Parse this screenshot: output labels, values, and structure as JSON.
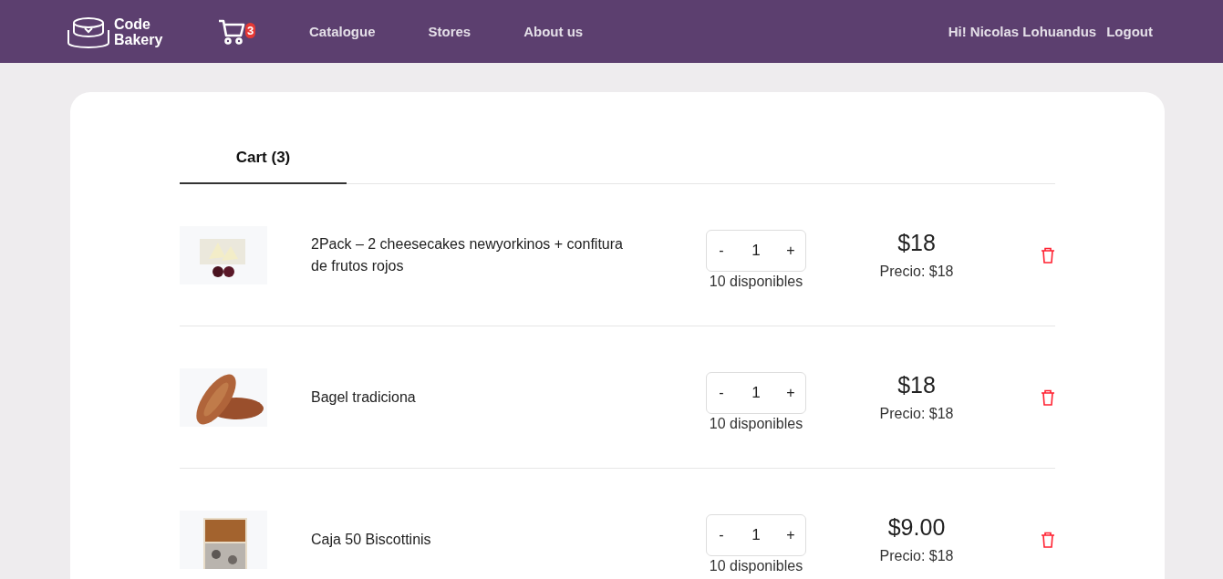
{
  "header": {
    "logo": [
      "Code",
      "Bakery"
    ],
    "cart_count": "3",
    "nav": [
      "Catalogue",
      "Stores",
      "About us"
    ],
    "greeting": "Hi! Nicolas Lohuandus",
    "logout": "Logout"
  },
  "tabs": [
    {
      "label": "Cart (3)",
      "selected": true
    }
  ],
  "items": [
    {
      "name": "2Pack – 2 cheesecakes newyorkinos + confitura de frutos rojos",
      "quantity": "1",
      "minus": "-",
      "plus": "+",
      "stock": "10 disponibles",
      "total": "$18",
      "unit_price": "Precio: $18"
    },
    {
      "name": "Bagel tradiciona",
      "quantity": "1",
      "minus": "-",
      "plus": "+",
      "stock": "10 disponibles",
      "total": "$18",
      "unit_price": "Precio: $18"
    },
    {
      "name": "Caja 50 Biscottinis",
      "quantity": "1",
      "minus": "-",
      "plus": "+",
      "stock": "10 disponibles",
      "total": "$9.00",
      "unit_price": "Precio: $18"
    }
  ]
}
